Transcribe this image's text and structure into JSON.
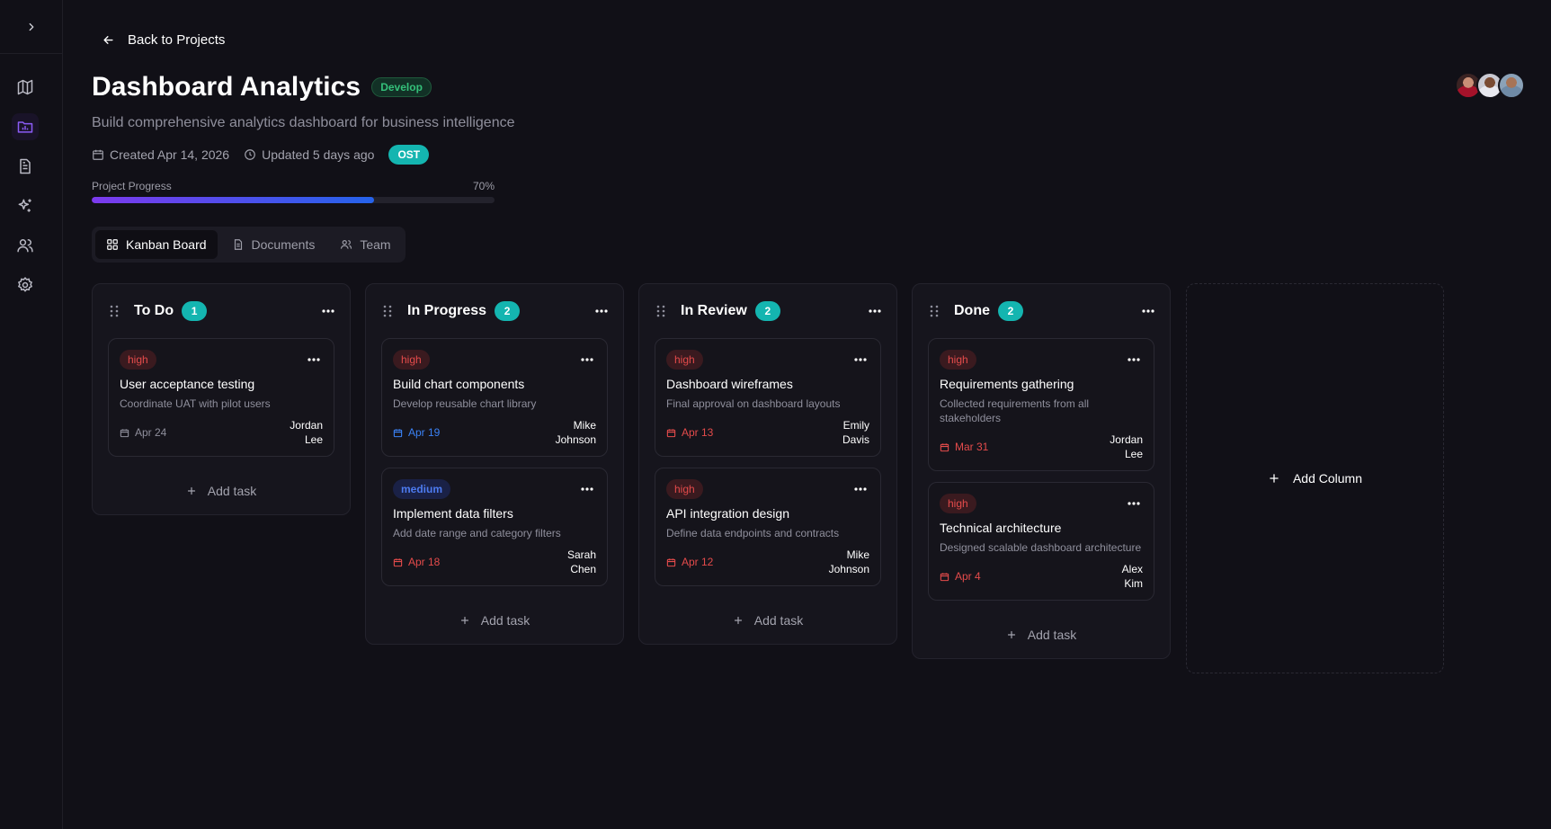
{
  "nav": {
    "back_label": "Back to Projects",
    "sidebar_icons": [
      "chevron-right-icon",
      "map-icon",
      "project-folder-icon",
      "document-icon",
      "sparkle-icon",
      "users-icon",
      "settings-icon"
    ]
  },
  "project": {
    "title": "Dashboard Analytics",
    "stage_badge": "Develop",
    "description": "Build comprehensive analytics dashboard for business intelligence",
    "created": "Created Apr 14, 2026",
    "updated": "Updated 5 days ago",
    "tag": "OST",
    "progress_label": "Project Progress",
    "progress_text": "70%",
    "progress_value": 0.7
  },
  "tabs": [
    {
      "label": "Kanban Board"
    },
    {
      "label": "Documents"
    },
    {
      "label": "Team"
    }
  ],
  "columns": [
    {
      "title": "To Do",
      "count": "1",
      "add_task_label": "Add task",
      "cards": [
        {
          "priority": "high",
          "title": "User acceptance testing",
          "description": "Coordinate UAT with pilot users",
          "due": "Apr 24",
          "due_color": "gray",
          "assignee_first": "Jordan",
          "assignee_last": "Lee"
        }
      ]
    },
    {
      "title": "In Progress",
      "count": "2",
      "add_task_label": "Add task",
      "cards": [
        {
          "priority": "high",
          "title": "Build chart components",
          "description": "Develop reusable chart library",
          "due": "Apr 19",
          "due_color": "blue",
          "assignee_first": "Mike",
          "assignee_last": "Johnson"
        },
        {
          "priority": "medium",
          "title": "Implement data filters",
          "description": "Add date range and category filters",
          "due": "Apr 18",
          "due_color": "red",
          "assignee_first": "Sarah",
          "assignee_last": "Chen"
        }
      ]
    },
    {
      "title": "In Review",
      "count": "2",
      "add_task_label": "Add task",
      "cards": [
        {
          "priority": "high",
          "title": "Dashboard wireframes",
          "description": "Final approval on dashboard layouts",
          "due": "Apr 13",
          "due_color": "red",
          "assignee_first": "Emily",
          "assignee_last": "Davis"
        },
        {
          "priority": "high",
          "title": "API integration design",
          "description": "Define data endpoints and contracts",
          "due": "Apr 12",
          "due_color": "red",
          "assignee_first": "Mike",
          "assignee_last": "Johnson"
        }
      ]
    },
    {
      "title": "Done",
      "count": "2",
      "add_task_label": "Add task",
      "cards": [
        {
          "priority": "high",
          "title": "Requirements gathering",
          "description": "Collected requirements from all stakeholders",
          "due": "Mar 31",
          "due_color": "red",
          "assignee_first": "Jordan",
          "assignee_last": "Lee"
        },
        {
          "priority": "high",
          "title": "Technical architecture",
          "description": "Designed scalable dashboard architecture",
          "due": "Apr 4",
          "due_color": "red",
          "assignee_first": "Alex",
          "assignee_last": "Kim"
        }
      ]
    }
  ],
  "add_column_label": "Add Column",
  "colors": {
    "background": "#111017",
    "accent_teal": "#14b5b0",
    "accent_purple": "#7c3aed",
    "priority_high": "#e44b4b",
    "priority_medium": "#4d7bf0",
    "develop_green": "#34c07a"
  }
}
